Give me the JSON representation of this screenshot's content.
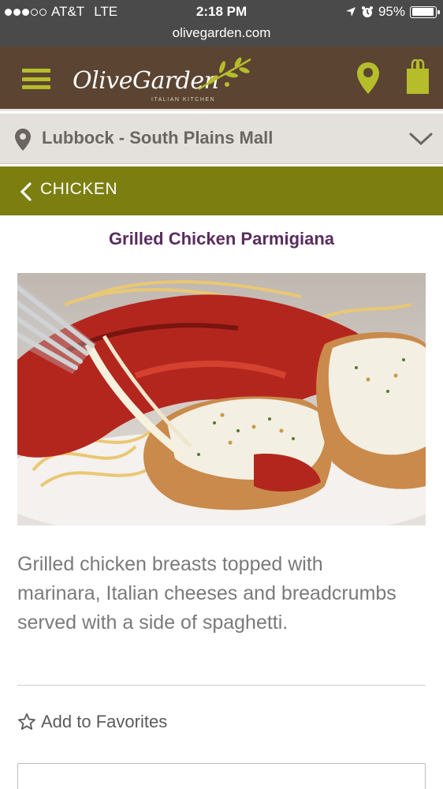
{
  "status_bar": {
    "carrier": "AT&T",
    "network": "LTE",
    "time": "2:18 PM",
    "battery": "95%",
    "battery_level": 0.95,
    "signal_bars_filled": 3,
    "signal_bars_total": 5
  },
  "browser": {
    "url": "olivegarden.com"
  },
  "header": {
    "logo_text": "OliveGarden",
    "logo_subtitle": "ITALIAN KITCHEN",
    "menu_icon": "hamburger-icon",
    "location_icon": "map-pin-icon",
    "bag_icon": "shopping-bag-icon",
    "brand_color": "#5b4432",
    "accent_color": "#b5bd2b"
  },
  "location": {
    "name": "Lubbock - South Plains Mall",
    "icon": "map-pin-icon",
    "expand_icon": "chevron-down-icon"
  },
  "category": {
    "label": "CHICKEN",
    "back_icon": "chevron-left-icon",
    "color": "#7c7f10"
  },
  "item": {
    "title": "Grilled Chicken Parmigiana",
    "description": "Grilled chicken breasts topped with marinara, Italian cheeses and breadcrumbs served with a side of spaghetti.",
    "favorite_label": "Add to Favorites",
    "favorite_icon": "star-outline-icon",
    "title_color": "#5a2c5f"
  }
}
